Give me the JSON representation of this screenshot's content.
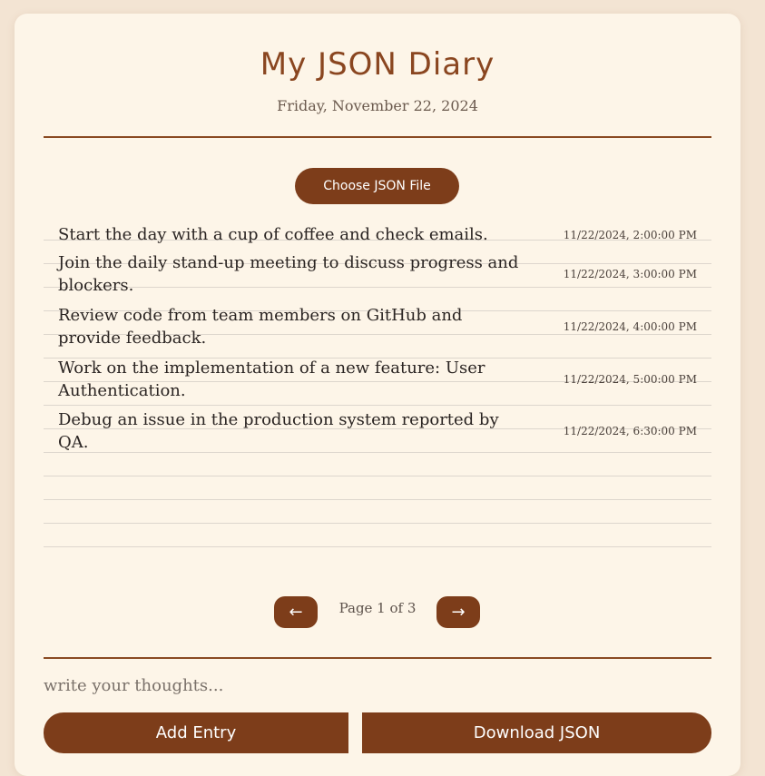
{
  "header": {
    "title": "My JSON Diary",
    "date": "Friday, November 22, 2024"
  },
  "file_picker": {
    "label": "Choose JSON File"
  },
  "entries": [
    {
      "text": "Start the day with a cup of coffee and check emails.",
      "time": "11/22/2024, 2:00:00 PM"
    },
    {
      "text": "Join the daily stand-up meeting to discuss progress and blockers.",
      "time": "11/22/2024, 3:00:00 PM"
    },
    {
      "text": "Review code from team members on GitHub and provide feedback.",
      "time": "11/22/2024, 4:00:00 PM"
    },
    {
      "text": "Work on the implementation of a new feature: User Authentication.",
      "time": "11/22/2024, 5:00:00 PM"
    },
    {
      "text": "Debug an issue in the production system reported by QA.",
      "time": "11/22/2024, 6:30:00 PM"
    }
  ],
  "pagination": {
    "prev_icon": "←",
    "next_icon": "→",
    "label": "Page 1 of 3"
  },
  "composer": {
    "placeholder": "write your thoughts...",
    "value": ""
  },
  "actions": {
    "add_label": "Add Entry",
    "download_label": "Download JSON"
  },
  "colors": {
    "accent": "#7d3d1a",
    "background": "#f3e4d3",
    "card": "#fdf5e8"
  }
}
